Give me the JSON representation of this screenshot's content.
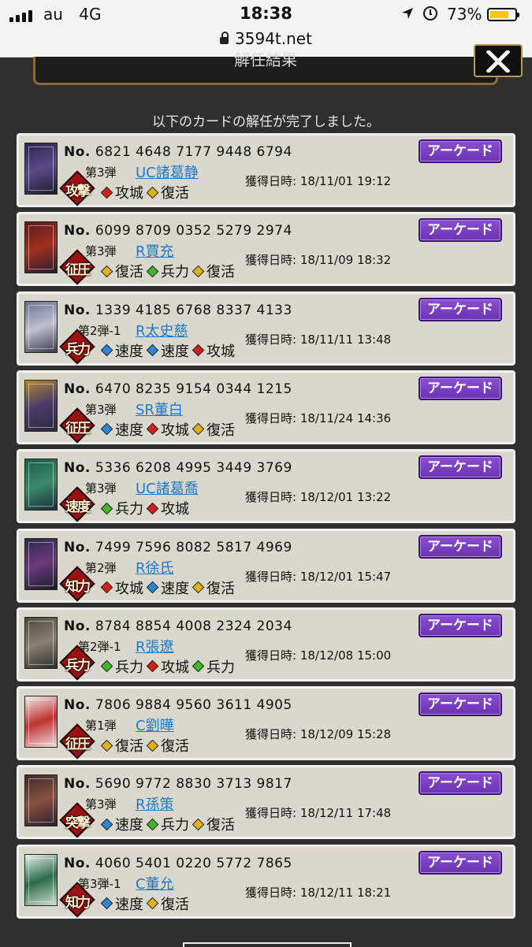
{
  "status_bar": {
    "carrier": "au",
    "network": "4G",
    "time": "18:38",
    "battery_percent": "73%",
    "battery_level": 0.73,
    "url": "3594t.net",
    "battery_color": "#f6c800"
  },
  "dialog": {
    "title": "解任結果",
    "close_icon": "close-x-icon",
    "notice": "以下のカードの解任が完了しました。"
  },
  "labels": {
    "no_prefix": "No.",
    "acquired_prefix": "獲得日時:",
    "arcade_button": "アーケード"
  },
  "colors": {
    "gem_red": "#d0211b",
    "gem_green": "#3fb52a",
    "gem_blue": "#2c86d6",
    "gem_yellow": "#e0b21a",
    "arcade_purple": "#7a3fc4",
    "badge_red": "#9e1010",
    "link_blue": "#1f79c8"
  },
  "cards": [
    {
      "number": "6821 4648 7177 9448 6794",
      "edition": "第3弾",
      "name": "UC諸葛静",
      "badge": "攻撃",
      "skills": [
        {
          "label": "攻城",
          "color": "red"
        },
        {
          "label": "復活",
          "color": "yellow"
        }
      ],
      "acquired": "18/11/01 19:12",
      "thumb_colors": [
        "#2a2548",
        "#5a4a8a",
        "#1a1a2a"
      ]
    },
    {
      "number": "6099 8709 0352 5279 2974",
      "edition": "第3弾",
      "name": "R賈充",
      "badge": "征圧",
      "skills": [
        {
          "label": "復活",
          "color": "yellow"
        },
        {
          "label": "兵力",
          "color": "green"
        },
        {
          "label": "復活",
          "color": "yellow"
        }
      ],
      "acquired": "18/11/09 18:32",
      "thumb_colors": [
        "#5a1a1a",
        "#a03020",
        "#2a1a2a"
      ]
    },
    {
      "number": "1339 4185 6768 8337 4133",
      "edition": "第2弾-1",
      "name": "R太史慈",
      "badge": "兵力",
      "skills": [
        {
          "label": "速度",
          "color": "blue"
        },
        {
          "label": "速度",
          "color": "blue"
        },
        {
          "label": "攻城",
          "color": "red"
        }
      ],
      "acquired": "18/11/11 13:48",
      "thumb_colors": [
        "#6a7090",
        "#c0c0d0",
        "#3a3a50"
      ]
    },
    {
      "number": "6470 8235 9154 0344 1215",
      "edition": "第3弾",
      "name": "SR董白",
      "badge": "征圧",
      "skills": [
        {
          "label": "速度",
          "color": "blue"
        },
        {
          "label": "攻城",
          "color": "red"
        },
        {
          "label": "復活",
          "color": "yellow"
        }
      ],
      "acquired": "18/11/24 14:36",
      "thumb_colors": [
        "#b08a30",
        "#4a3a6a",
        "#2a2a3a"
      ]
    },
    {
      "number": "5336 6208 4995 3449 3769",
      "edition": "第3弾",
      "name": "UC諸葛喬",
      "badge": "速度",
      "skills": [
        {
          "label": "兵力",
          "color": "green"
        },
        {
          "label": "攻城",
          "color": "red"
        }
      ],
      "acquired": "18/12/01 13:22",
      "thumb_colors": [
        "#1f5a4a",
        "#3a8a6a",
        "#1a2a3a"
      ]
    },
    {
      "number": "7499 7596 8082 5817 4969",
      "edition": "第2弾",
      "name": "R徐氏",
      "badge": "知力",
      "skills": [
        {
          "label": "攻城",
          "color": "red"
        },
        {
          "label": "速度",
          "color": "blue"
        },
        {
          "label": "復活",
          "color": "yellow"
        }
      ],
      "acquired": "18/12/01 15:47",
      "thumb_colors": [
        "#2a2a4a",
        "#6a3a7a",
        "#1a1a2a"
      ]
    },
    {
      "number": "8784 8854 4008 2324 2034",
      "edition": "第2弾-1",
      "name": "R張遼",
      "badge": "兵力",
      "skills": [
        {
          "label": "兵力",
          "color": "green"
        },
        {
          "label": "攻城",
          "color": "red"
        },
        {
          "label": "兵力",
          "color": "green"
        }
      ],
      "acquired": "18/12/08 15:00",
      "thumb_colors": [
        "#4a4a40",
        "#8a8070",
        "#2a2a2a"
      ]
    },
    {
      "number": "7806 9884 9560 3611 4905",
      "edition": "第1弾",
      "name": "C劉曄",
      "badge": "征圧",
      "skills": [
        {
          "label": "復活",
          "color": "yellow"
        },
        {
          "label": "復活",
          "color": "yellow"
        }
      ],
      "acquired": "18/12/09 15:28",
      "thumb_colors": [
        "#eeeeee",
        "#c03030",
        "#f0e0e0"
      ]
    },
    {
      "number": "5690 9772 8830 3713 9817",
      "edition": "第3弾",
      "name": "R孫策",
      "badge": "突撃",
      "skills": [
        {
          "label": "速度",
          "color": "blue"
        },
        {
          "label": "兵力",
          "color": "green"
        },
        {
          "label": "復活",
          "color": "yellow"
        }
      ],
      "acquired": "18/12/11 17:48",
      "thumb_colors": [
        "#3a2a2a",
        "#8a5040",
        "#2a2030"
      ]
    },
    {
      "number": "4060 5401 0220 5772 7865",
      "edition": "第3弾-1",
      "name": "C董允",
      "badge": "知力",
      "skills": [
        {
          "label": "速度",
          "color": "blue"
        },
        {
          "label": "復活",
          "color": "yellow"
        }
      ],
      "acquired": "18/12/11 18:21",
      "thumb_colors": [
        "#e8f0e8",
        "#2a6a4a",
        "#d0e0d0"
      ]
    }
  ]
}
